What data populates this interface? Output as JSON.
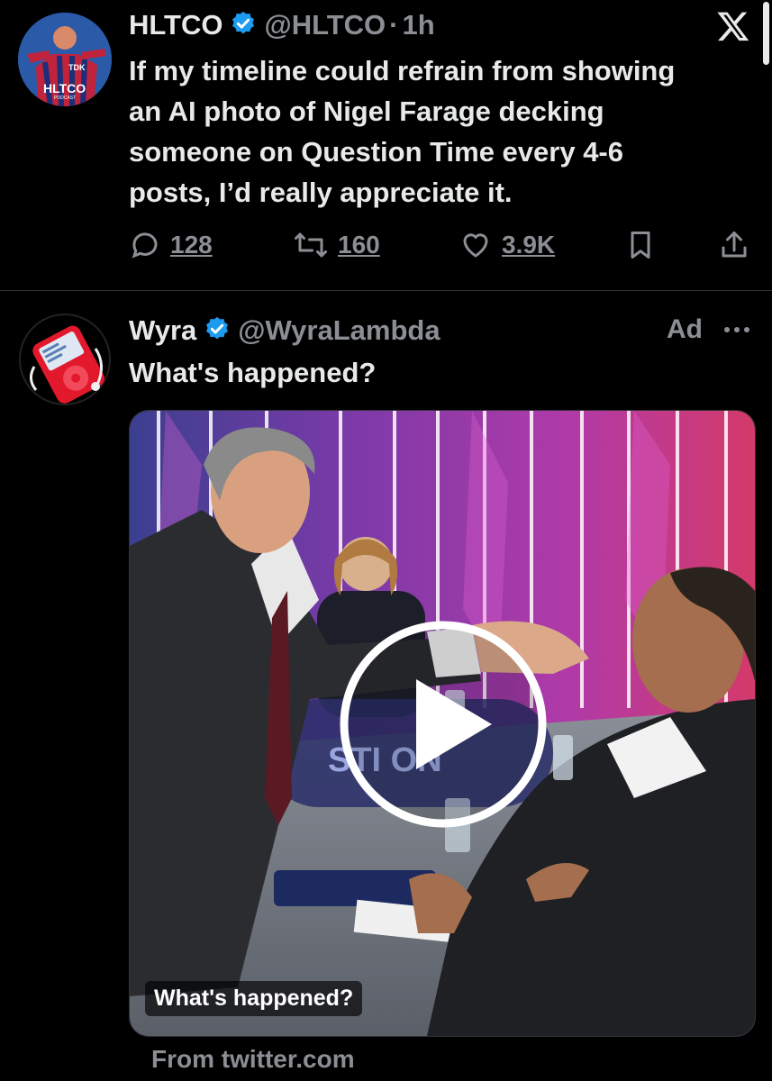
{
  "tweet1": {
    "name": "HLTCO",
    "handle": "@HLTCO",
    "separator": "·",
    "time": "1h",
    "avatar_text": "HLTCO",
    "avatar_subtext": "PODCAST",
    "avatar_badge": "TDK",
    "text_lines": [
      "If my timeline could refrain from showing",
      "an AI photo of Nigel Farage decking",
      "someone on Question Time every 4-6",
      "posts, I’d really appreciate it."
    ],
    "replies": "128",
    "retweets": "160",
    "likes": "3.9K",
    "source_icon": "x-logo-icon"
  },
  "tweet2": {
    "name": "Wyra",
    "handle": "@WyraLambda",
    "ad_label": "Ad",
    "text": "What's happened?",
    "media_caption": "What's happened?",
    "media_overlay_text": "STI ON",
    "source": "From twitter.com"
  },
  "colors": {
    "background": "#000000",
    "text": "#e7e9ea",
    "secondary": "#8b8f94",
    "verified": "#1d9bf0",
    "divider": "#2f3336"
  }
}
